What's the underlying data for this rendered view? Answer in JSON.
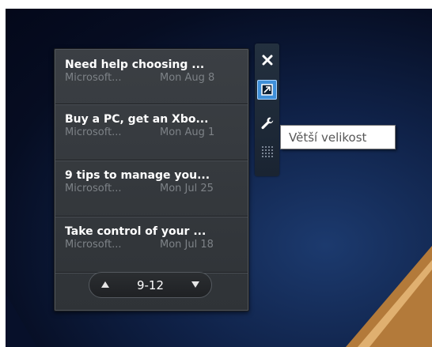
{
  "feed": {
    "items": [
      {
        "title": "Need help choosing ...",
        "source": "Microsoft...",
        "date": "Mon Aug 8"
      },
      {
        "title": "Buy a PC, get an Xbo...",
        "source": "Microsoft...",
        "date": "Mon Aug 1"
      },
      {
        "title": "9 tips to manage you...",
        "source": "Microsoft...",
        "date": "Mon Jul 25"
      },
      {
        "title": "Take control of your ...",
        "source": "Microsoft...",
        "date": "Mon Jul 18"
      }
    ]
  },
  "pager": {
    "range": "9-12",
    "prev_icon": "up-triangle-icon",
    "next_icon": "down-triangle-icon"
  },
  "toolbar": {
    "close_icon": "close-icon",
    "size_icon": "larger-size-icon",
    "options_icon": "wrench-icon",
    "drag_icon": "drag-grip-icon"
  },
  "tooltip": {
    "text": "Větší velikost"
  },
  "colors": {
    "accent": "#3f8fd8",
    "desktop": "#0f2147"
  }
}
